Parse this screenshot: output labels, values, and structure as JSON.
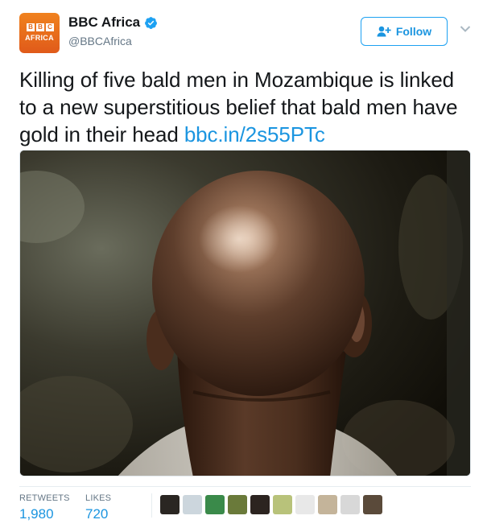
{
  "account": {
    "display_name": "BBC Africa",
    "handle": "@BBCAfrica",
    "verified": true,
    "avatar_text": {
      "letters": [
        "B",
        "B",
        "C"
      ],
      "subtitle": "AFRICA"
    }
  },
  "follow_button": {
    "label": "Follow"
  },
  "tweet": {
    "text": "Killing of five bald men in Mozambique is linked to a new superstitious belief that bald men have gold in their head ",
    "link": "bbc.in/2s55PTc"
  },
  "stats": {
    "retweets_label": "RETWEETS",
    "retweets_count": "1,980",
    "likes_label": "LIKES",
    "likes_count": "720"
  },
  "likers": [
    {
      "name": "liker-avatar-1",
      "color": "#2a2622"
    },
    {
      "name": "liker-avatar-2",
      "color": "#ccd6dd"
    },
    {
      "name": "liker-avatar-3",
      "color": "#3a8a4a"
    },
    {
      "name": "liker-avatar-4",
      "color": "#6a7a3a"
    },
    {
      "name": "liker-avatar-5",
      "color": "#2c2420"
    },
    {
      "name": "liker-avatar-6",
      "color": "#b8c27a"
    },
    {
      "name": "liker-avatar-7",
      "color": "#e8e8e8"
    },
    {
      "name": "liker-avatar-8",
      "color": "#c4b49a"
    },
    {
      "name": "liker-avatar-9",
      "color": "#d8d8d8"
    },
    {
      "name": "liker-avatar-10",
      "color": "#5a4a3a"
    }
  ],
  "colors": {
    "accent": "#1b95e0",
    "brand_orange": "#e46a1c",
    "text_secondary": "#657786"
  }
}
